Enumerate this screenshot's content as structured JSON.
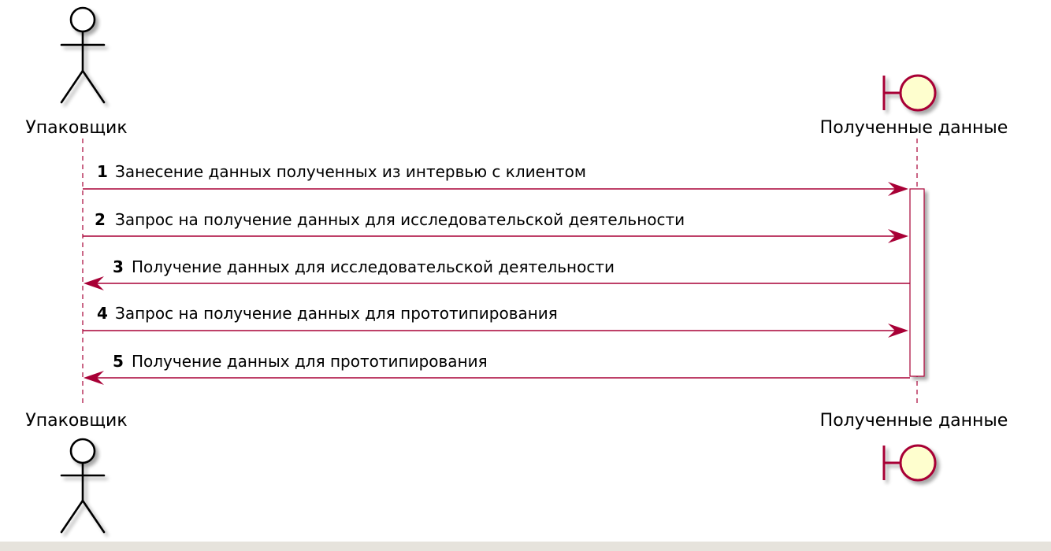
{
  "diagram": {
    "participants": [
      {
        "id": "packer",
        "name": "Упаковщик",
        "kind": "actor"
      },
      {
        "id": "data",
        "name": "Полученные данные",
        "kind": "boundary"
      }
    ],
    "messages": [
      {
        "num": "1",
        "text": "Занесение данных полученных из интервью с клиентом",
        "from": "packer",
        "to": "data"
      },
      {
        "num": "2",
        "text": "Запрос на получение данных для исследовательской деятельности",
        "from": "packer",
        "to": "data"
      },
      {
        "num": "3",
        "text": "Получение данных для исследовательской деятельности",
        "from": "data",
        "to": "packer"
      },
      {
        "num": "4",
        "text": "Запрос на получение данных для прототипирования",
        "from": "packer",
        "to": "data"
      },
      {
        "num": "5",
        "text": "Получение данных для прототипирования",
        "from": "data",
        "to": "packer"
      }
    ],
    "colors": {
      "arrow": "#a80036",
      "boundary_fill": "#fefece",
      "lifeline": "#a80036",
      "actor_fill": "#ffffff",
      "footer": "#e6e3dc"
    }
  }
}
